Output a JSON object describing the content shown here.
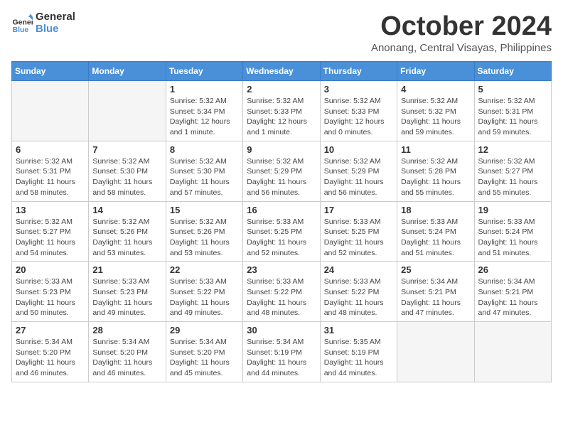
{
  "logo": {
    "general": "General",
    "blue": "Blue"
  },
  "header": {
    "month": "October 2024",
    "location": "Anonang, Central Visayas, Philippines"
  },
  "weekdays": [
    "Sunday",
    "Monday",
    "Tuesday",
    "Wednesday",
    "Thursday",
    "Friday",
    "Saturday"
  ],
  "weeks": [
    [
      {
        "day": "",
        "info": ""
      },
      {
        "day": "",
        "info": ""
      },
      {
        "day": "1",
        "info": "Sunrise: 5:32 AM\nSunset: 5:34 PM\nDaylight: 12 hours\nand 1 minute."
      },
      {
        "day": "2",
        "info": "Sunrise: 5:32 AM\nSunset: 5:33 PM\nDaylight: 12 hours\nand 1 minute."
      },
      {
        "day": "3",
        "info": "Sunrise: 5:32 AM\nSunset: 5:33 PM\nDaylight: 12 hours\nand 0 minutes."
      },
      {
        "day": "4",
        "info": "Sunrise: 5:32 AM\nSunset: 5:32 PM\nDaylight: 11 hours\nand 59 minutes."
      },
      {
        "day": "5",
        "info": "Sunrise: 5:32 AM\nSunset: 5:31 PM\nDaylight: 11 hours\nand 59 minutes."
      }
    ],
    [
      {
        "day": "6",
        "info": "Sunrise: 5:32 AM\nSunset: 5:31 PM\nDaylight: 11 hours\nand 58 minutes."
      },
      {
        "day": "7",
        "info": "Sunrise: 5:32 AM\nSunset: 5:30 PM\nDaylight: 11 hours\nand 58 minutes."
      },
      {
        "day": "8",
        "info": "Sunrise: 5:32 AM\nSunset: 5:30 PM\nDaylight: 11 hours\nand 57 minutes."
      },
      {
        "day": "9",
        "info": "Sunrise: 5:32 AM\nSunset: 5:29 PM\nDaylight: 11 hours\nand 56 minutes."
      },
      {
        "day": "10",
        "info": "Sunrise: 5:32 AM\nSunset: 5:29 PM\nDaylight: 11 hours\nand 56 minutes."
      },
      {
        "day": "11",
        "info": "Sunrise: 5:32 AM\nSunset: 5:28 PM\nDaylight: 11 hours\nand 55 minutes."
      },
      {
        "day": "12",
        "info": "Sunrise: 5:32 AM\nSunset: 5:27 PM\nDaylight: 11 hours\nand 55 minutes."
      }
    ],
    [
      {
        "day": "13",
        "info": "Sunrise: 5:32 AM\nSunset: 5:27 PM\nDaylight: 11 hours\nand 54 minutes."
      },
      {
        "day": "14",
        "info": "Sunrise: 5:32 AM\nSunset: 5:26 PM\nDaylight: 11 hours\nand 53 minutes."
      },
      {
        "day": "15",
        "info": "Sunrise: 5:32 AM\nSunset: 5:26 PM\nDaylight: 11 hours\nand 53 minutes."
      },
      {
        "day": "16",
        "info": "Sunrise: 5:33 AM\nSunset: 5:25 PM\nDaylight: 11 hours\nand 52 minutes."
      },
      {
        "day": "17",
        "info": "Sunrise: 5:33 AM\nSunset: 5:25 PM\nDaylight: 11 hours\nand 52 minutes."
      },
      {
        "day": "18",
        "info": "Sunrise: 5:33 AM\nSunset: 5:24 PM\nDaylight: 11 hours\nand 51 minutes."
      },
      {
        "day": "19",
        "info": "Sunrise: 5:33 AM\nSunset: 5:24 PM\nDaylight: 11 hours\nand 51 minutes."
      }
    ],
    [
      {
        "day": "20",
        "info": "Sunrise: 5:33 AM\nSunset: 5:23 PM\nDaylight: 11 hours\nand 50 minutes."
      },
      {
        "day": "21",
        "info": "Sunrise: 5:33 AM\nSunset: 5:23 PM\nDaylight: 11 hours\nand 49 minutes."
      },
      {
        "day": "22",
        "info": "Sunrise: 5:33 AM\nSunset: 5:22 PM\nDaylight: 11 hours\nand 49 minutes."
      },
      {
        "day": "23",
        "info": "Sunrise: 5:33 AM\nSunset: 5:22 PM\nDaylight: 11 hours\nand 48 minutes."
      },
      {
        "day": "24",
        "info": "Sunrise: 5:33 AM\nSunset: 5:22 PM\nDaylight: 11 hours\nand 48 minutes."
      },
      {
        "day": "25",
        "info": "Sunrise: 5:34 AM\nSunset: 5:21 PM\nDaylight: 11 hours\nand 47 minutes."
      },
      {
        "day": "26",
        "info": "Sunrise: 5:34 AM\nSunset: 5:21 PM\nDaylight: 11 hours\nand 47 minutes."
      }
    ],
    [
      {
        "day": "27",
        "info": "Sunrise: 5:34 AM\nSunset: 5:20 PM\nDaylight: 11 hours\nand 46 minutes."
      },
      {
        "day": "28",
        "info": "Sunrise: 5:34 AM\nSunset: 5:20 PM\nDaylight: 11 hours\nand 46 minutes."
      },
      {
        "day": "29",
        "info": "Sunrise: 5:34 AM\nSunset: 5:20 PM\nDaylight: 11 hours\nand 45 minutes."
      },
      {
        "day": "30",
        "info": "Sunrise: 5:34 AM\nSunset: 5:19 PM\nDaylight: 11 hours\nand 44 minutes."
      },
      {
        "day": "31",
        "info": "Sunrise: 5:35 AM\nSunset: 5:19 PM\nDaylight: 11 hours\nand 44 minutes."
      },
      {
        "day": "",
        "info": ""
      },
      {
        "day": "",
        "info": ""
      }
    ]
  ]
}
